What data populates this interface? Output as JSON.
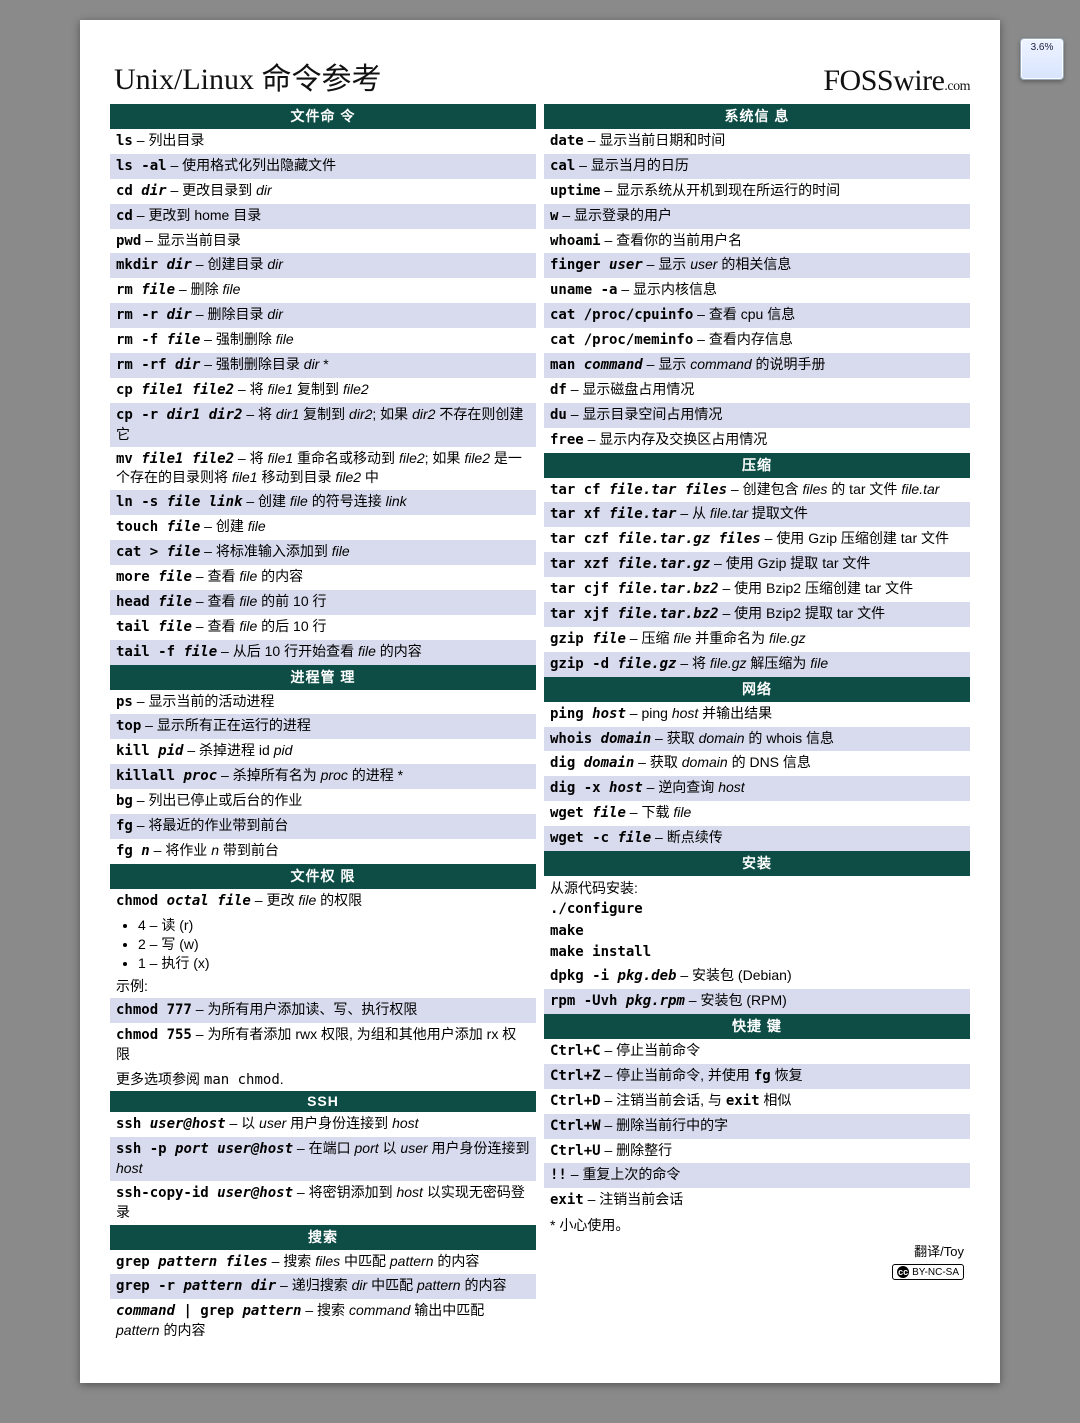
{
  "widget_label": "3.6%",
  "title": "Unix/Linux 命令参考",
  "brand_main": "FOSSwire",
  "brand_suffix": ".com",
  "translator": "翻译/Toy <http://LinuxTOY.org>",
  "cc_text": "BY-NC-SA",
  "careful": "* 小心使用。",
  "left": [
    {
      "type": "head",
      "text": "文件命 令"
    },
    {
      "type": "row",
      "cmd": [
        {
          "t": "ls",
          "b": 1
        }
      ],
      "desc": "列出目录"
    },
    {
      "type": "row",
      "cmd": [
        {
          "t": "ls -al",
          "b": 1
        }
      ],
      "desc": "使用格式化列出隐藏文件"
    },
    {
      "type": "row",
      "cmd": [
        {
          "t": "cd ",
          "b": 1
        },
        {
          "t": "dir",
          "b": 1,
          "i": 1
        }
      ],
      "desc": "更改目录到 <i>dir</i>"
    },
    {
      "type": "row",
      "cmd": [
        {
          "t": "cd",
          "b": 1
        }
      ],
      "desc": "更改到 home 目录"
    },
    {
      "type": "row",
      "cmd": [
        {
          "t": "pwd",
          "b": 1
        }
      ],
      "desc": "显示当前目录"
    },
    {
      "type": "row",
      "cmd": [
        {
          "t": "mkdir ",
          "b": 1
        },
        {
          "t": "dir",
          "b": 1,
          "i": 1
        }
      ],
      "desc": "创建目录 <i>dir</i>"
    },
    {
      "type": "row",
      "cmd": [
        {
          "t": "rm ",
          "b": 1
        },
        {
          "t": "file",
          "b": 1,
          "i": 1
        }
      ],
      "desc": "删除 <i>file</i>"
    },
    {
      "type": "row",
      "cmd": [
        {
          "t": "rm -r ",
          "b": 1
        },
        {
          "t": "dir",
          "b": 1,
          "i": 1
        }
      ],
      "desc": "删除目录 <i>dir</i>"
    },
    {
      "type": "row",
      "cmd": [
        {
          "t": "rm -f ",
          "b": 1
        },
        {
          "t": "file",
          "b": 1,
          "i": 1
        }
      ],
      "desc": "强制删除 <i>file</i>"
    },
    {
      "type": "row",
      "cmd": [
        {
          "t": "rm -rf ",
          "b": 1
        },
        {
          "t": "dir",
          "b": 1,
          "i": 1
        }
      ],
      "desc": "强制删除目录 <i>dir</i> *"
    },
    {
      "type": "row",
      "cmd": [
        {
          "t": "cp ",
          "b": 1
        },
        {
          "t": "file1 file2",
          "b": 1,
          "i": 1
        }
      ],
      "desc": "将 <i>file1</i> 复制到 <i>file2</i>"
    },
    {
      "type": "row",
      "cmd": [
        {
          "t": "cp -r ",
          "b": 1
        },
        {
          "t": "dir1 dir2",
          "b": 1,
          "i": 1
        }
      ],
      "desc": "将 <i>dir1</i> 复制到 <i>dir2</i>; 如果 <i>dir2</i> 不存在则创建它"
    },
    {
      "type": "row",
      "cmd": [
        {
          "t": "mv ",
          "b": 1
        },
        {
          "t": "file1 file2",
          "b": 1,
          "i": 1
        }
      ],
      "desc": "将 <i>file1</i> 重命名或移动到 <i>file2</i>; 如果 <i>file2</i> 是一个存在的目录则将 <i>file1</i> 移动到目录 <i>file2</i> 中"
    },
    {
      "type": "row",
      "cmd": [
        {
          "t": "ln -s ",
          "b": 1
        },
        {
          "t": "file link",
          "b": 1,
          "i": 1
        }
      ],
      "desc": "创建 <i>file</i> 的符号连接 <i>link</i>"
    },
    {
      "type": "row",
      "cmd": [
        {
          "t": "touch ",
          "b": 1
        },
        {
          "t": "file",
          "b": 1,
          "i": 1
        }
      ],
      "desc": "创建 <i>file</i>"
    },
    {
      "type": "row",
      "cmd": [
        {
          "t": "cat > ",
          "b": 1
        },
        {
          "t": "file",
          "b": 1,
          "i": 1
        }
      ],
      "desc": "将标准输入添加到 <i>file</i>"
    },
    {
      "type": "row",
      "cmd": [
        {
          "t": "more ",
          "b": 1
        },
        {
          "t": "file",
          "b": 1,
          "i": 1
        }
      ],
      "desc": "查看 <i>file</i> 的内容"
    },
    {
      "type": "row",
      "cmd": [
        {
          "t": "head ",
          "b": 1
        },
        {
          "t": "file",
          "b": 1,
          "i": 1
        }
      ],
      "desc": "查看 <i>file</i> 的前 10 行"
    },
    {
      "type": "row",
      "cmd": [
        {
          "t": "tail ",
          "b": 1
        },
        {
          "t": "file",
          "b": 1,
          "i": 1
        }
      ],
      "desc": "查看 <i>file</i> 的后 10 行"
    },
    {
      "type": "row",
      "cmd": [
        {
          "t": "tail -f ",
          "b": 1
        },
        {
          "t": "file",
          "b": 1,
          "i": 1
        }
      ],
      "desc": "从后 10 行开始查看 <i>file</i> 的内容"
    },
    {
      "type": "head",
      "text": "进程管 理"
    },
    {
      "type": "row",
      "cmd": [
        {
          "t": "ps",
          "b": 1
        }
      ],
      "desc": "显示当前的活动进程"
    },
    {
      "type": "row",
      "cmd": [
        {
          "t": "top",
          "b": 1
        }
      ],
      "desc": "显示所有正在运行的进程"
    },
    {
      "type": "row",
      "cmd": [
        {
          "t": "kill ",
          "b": 1
        },
        {
          "t": "pid",
          "b": 1,
          "i": 1
        }
      ],
      "desc": "杀掉进程 id <i>pid</i>"
    },
    {
      "type": "row",
      "cmd": [
        {
          "t": "killall ",
          "b": 1
        },
        {
          "t": "proc",
          "b": 1,
          "i": 1
        }
      ],
      "desc": "杀掉所有名为 <i>proc</i> 的进程 *"
    },
    {
      "type": "row",
      "cmd": [
        {
          "t": "bg",
          "b": 1
        }
      ],
      "desc": "列出已停止或后台的作业"
    },
    {
      "type": "row",
      "cmd": [
        {
          "t": "fg",
          "b": 1
        }
      ],
      "desc": "将最近的作业带到前台"
    },
    {
      "type": "row",
      "cmd": [
        {
          "t": "fg ",
          "b": 1
        },
        {
          "t": "n",
          "b": 1,
          "i": 1
        }
      ],
      "desc": "将作业 <i>n</i> 带到前台"
    },
    {
      "type": "head",
      "text": "文件权 限"
    },
    {
      "type": "row",
      "cmd": [
        {
          "t": "chmod ",
          "b": 1
        },
        {
          "t": "octal file",
          "b": 1,
          "i": 1
        }
      ],
      "desc": "更改 <i>file</i> 的权限"
    },
    {
      "type": "raw",
      "html": "<ul class='oct'><li>4 – 读 (r)</li><li>2 – 写 (w)</li><li>1 – 执行 (x)</li></ul>"
    },
    {
      "type": "raw",
      "html": "<div class='note'>示例:</div>"
    },
    {
      "type": "row",
      "cmd": [
        {
          "t": "chmod 777",
          "b": 1
        }
      ],
      "desc": "为所有用户添加读、写、执行权限"
    },
    {
      "type": "row",
      "cmd": [
        {
          "t": "chmod 755",
          "b": 1
        }
      ],
      "desc": "为所有者添加 rwx 权限, 为组和其他用户添加 rx 权限"
    },
    {
      "type": "raw",
      "html": "<div class='note'>更多选项参阅 <span class='mono'>man chmod</span>.</div>"
    },
    {
      "type": "head",
      "text": "SSH"
    },
    {
      "type": "row",
      "cmd": [
        {
          "t": "ssh ",
          "b": 1
        },
        {
          "t": "user@host",
          "b": 1,
          "i": 1
        }
      ],
      "desc": "以 <i>user</i> 用户身份连接到 <i>host</i>"
    },
    {
      "type": "row",
      "cmd": [
        {
          "t": "ssh -p ",
          "b": 1
        },
        {
          "t": "port user@host",
          "b": 1,
          "i": 1
        }
      ],
      "desc": "在端口 <i>port</i> 以 <i>user</i> 用户身份连接到 <i>host</i>"
    },
    {
      "type": "row",
      "cmd": [
        {
          "t": "ssh-copy-id ",
          "b": 1
        },
        {
          "t": "user@host",
          "b": 1,
          "i": 1
        }
      ],
      "desc": "将密钥添加到 <i>host</i> 以实现无密码登录"
    },
    {
      "type": "head",
      "text": "搜索"
    },
    {
      "type": "row",
      "cmd": [
        {
          "t": "grep ",
          "b": 1
        },
        {
          "t": "pattern files",
          "b": 1,
          "i": 1
        }
      ],
      "desc": "搜索 <i>files</i> 中匹配 <i>pattern</i> 的内容"
    },
    {
      "type": "row",
      "cmd": [
        {
          "t": "grep -r ",
          "b": 1
        },
        {
          "t": "pattern dir",
          "b": 1,
          "i": 1
        }
      ],
      "desc": "递归搜索 <i>dir</i> 中匹配 <i>pattern</i> 的内容"
    },
    {
      "type": "row",
      "cmd": [
        {
          "t": "command",
          "b": 1,
          "i": 1
        },
        {
          "t": " | grep ",
          "b": 1
        },
        {
          "t": "pattern",
          "b": 1,
          "i": 1
        }
      ],
      "desc": "搜索 <i>command</i> 输出中匹配 <i>pattern</i> 的内容"
    }
  ],
  "right": [
    {
      "type": "head",
      "text": "系统信 息"
    },
    {
      "type": "row",
      "cmd": [
        {
          "t": "date",
          "b": 1
        }
      ],
      "desc": "显示当前日期和时间"
    },
    {
      "type": "row",
      "cmd": [
        {
          "t": "cal",
          "b": 1
        }
      ],
      "desc": "显示当月的日历"
    },
    {
      "type": "row",
      "cmd": [
        {
          "t": "uptime",
          "b": 1
        }
      ],
      "desc": "显示系统从开机到现在所运行的时间"
    },
    {
      "type": "row",
      "cmd": [
        {
          "t": "w",
          "b": 1
        }
      ],
      "desc": "显示登录的用户"
    },
    {
      "type": "row",
      "cmd": [
        {
          "t": "whoami",
          "b": 1
        }
      ],
      "desc": "查看你的当前用户名"
    },
    {
      "type": "row",
      "cmd": [
        {
          "t": "finger ",
          "b": 1
        },
        {
          "t": "user",
          "b": 1,
          "i": 1
        }
      ],
      "desc": "显示 <i>user</i> 的相关信息"
    },
    {
      "type": "row",
      "cmd": [
        {
          "t": "uname -a",
          "b": 1
        }
      ],
      "desc": "显示内核信息"
    },
    {
      "type": "row",
      "cmd": [
        {
          "t": "cat /proc/cpuinfo",
          "b": 1
        }
      ],
      "desc": "查看 cpu 信息"
    },
    {
      "type": "row",
      "cmd": [
        {
          "t": "cat /proc/meminfo",
          "b": 1
        }
      ],
      "desc": "查看内存信息"
    },
    {
      "type": "row",
      "cmd": [
        {
          "t": "man ",
          "b": 1
        },
        {
          "t": "command",
          "b": 1,
          "i": 1
        }
      ],
      "desc": "显示 <i>command</i> 的说明手册"
    },
    {
      "type": "row",
      "cmd": [
        {
          "t": "df",
          "b": 1
        }
      ],
      "desc": "显示磁盘占用情况"
    },
    {
      "type": "row",
      "cmd": [
        {
          "t": "du",
          "b": 1
        }
      ],
      "desc": "显示目录空间占用情况"
    },
    {
      "type": "row",
      "cmd": [
        {
          "t": "free",
          "b": 1
        }
      ],
      "desc": "显示内存及交换区占用情况"
    },
    {
      "type": "head",
      "text": "压缩"
    },
    {
      "type": "row",
      "cmd": [
        {
          "t": "tar cf ",
          "b": 1
        },
        {
          "t": "file.tar files",
          "b": 1,
          "i": 1
        }
      ],
      "desc": "创建包含 <i>files</i> 的 tar 文件 <i>file.tar</i>"
    },
    {
      "type": "row",
      "cmd": [
        {
          "t": "tar xf ",
          "b": 1
        },
        {
          "t": "file.tar",
          "b": 1,
          "i": 1
        }
      ],
      "desc": "从 <i>file.tar</i> 提取文件"
    },
    {
      "type": "row",
      "cmd": [
        {
          "t": "tar czf ",
          "b": 1
        },
        {
          "t": "file.tar.gz files",
          "b": 1,
          "i": 1
        }
      ],
      "desc": "使用 Gzip 压缩创建 tar 文件"
    },
    {
      "type": "row",
      "cmd": [
        {
          "t": "tar xzf ",
          "b": 1
        },
        {
          "t": "file.tar.gz",
          "b": 1,
          "i": 1
        }
      ],
      "desc": "使用 Gzip 提取 tar 文件"
    },
    {
      "type": "row",
      "cmd": [
        {
          "t": "tar cjf ",
          "b": 1
        },
        {
          "t": "file.tar.bz2",
          "b": 1,
          "i": 1
        }
      ],
      "desc": "使用 Bzip2 压缩创建 tar 文件"
    },
    {
      "type": "row",
      "cmd": [
        {
          "t": "tar xjf ",
          "b": 1
        },
        {
          "t": "file.tar.bz2",
          "b": 1,
          "i": 1
        }
      ],
      "desc": "使用 Bzip2 提取 tar 文件"
    },
    {
      "type": "row",
      "cmd": [
        {
          "t": "gzip ",
          "b": 1
        },
        {
          "t": "file",
          "b": 1,
          "i": 1
        }
      ],
      "desc": "压缩 <i>file</i> 并重命名为 <i>file.gz</i>"
    },
    {
      "type": "row",
      "cmd": [
        {
          "t": "gzip -d ",
          "b": 1
        },
        {
          "t": "file.gz",
          "b": 1,
          "i": 1
        }
      ],
      "desc": "将 <i>file.gz</i> 解压缩为 <i>file</i>"
    },
    {
      "type": "head",
      "text": "网络"
    },
    {
      "type": "row",
      "cmd": [
        {
          "t": "ping ",
          "b": 1
        },
        {
          "t": "host",
          "b": 1,
          "i": 1
        }
      ],
      "desc": "ping <i>host</i> 并输出结果"
    },
    {
      "type": "row",
      "cmd": [
        {
          "t": "whois ",
          "b": 1
        },
        {
          "t": "domain",
          "b": 1,
          "i": 1
        }
      ],
      "desc": "获取 <i>domain</i> 的 whois 信息"
    },
    {
      "type": "row",
      "cmd": [
        {
          "t": "dig ",
          "b": 1
        },
        {
          "t": "domain",
          "b": 1,
          "i": 1
        }
      ],
      "desc": "获取 <i>domain</i> 的 DNS 信息"
    },
    {
      "type": "row",
      "cmd": [
        {
          "t": "dig -x ",
          "b": 1
        },
        {
          "t": "host",
          "b": 1,
          "i": 1
        }
      ],
      "desc": "逆向查询 <i>host</i>"
    },
    {
      "type": "row",
      "cmd": [
        {
          "t": "wget ",
          "b": 1
        },
        {
          "t": "file",
          "b": 1,
          "i": 1
        }
      ],
      "desc": "下载 <i>file</i>"
    },
    {
      "type": "row",
      "cmd": [
        {
          "t": "wget -c ",
          "b": 1
        },
        {
          "t": "file",
          "b": 1,
          "i": 1
        }
      ],
      "desc": "断点续传"
    },
    {
      "type": "head",
      "text": "安装"
    },
    {
      "type": "raw",
      "html": "<div class='freeblock'>从源代码安装:<br><span class='mono'><b>./configure</b><br><b>make</b><br><b>make install</b></span></div>"
    },
    {
      "type": "row",
      "cmd": [
        {
          "t": "dpkg -i ",
          "b": 1
        },
        {
          "t": "pkg.deb",
          "b": 1,
          "i": 1
        }
      ],
      "desc": "安装包 (Debian)"
    },
    {
      "type": "row",
      "cmd": [
        {
          "t": "rpm -Uvh ",
          "b": 1
        },
        {
          "t": "pkg.rpm",
          "b": 1,
          "i": 1
        }
      ],
      "desc": "安装包 (RPM)"
    },
    {
      "type": "head",
      "text": "快捷 键"
    },
    {
      "type": "row",
      "cmd": [
        {
          "t": "Ctrl+C",
          "b": 1
        }
      ],
      "desc": "停止当前命令"
    },
    {
      "type": "row",
      "cmd": [
        {
          "t": "Ctrl+Z",
          "b": 1
        }
      ],
      "desc": "停止当前命令, 并使用 <span class='mono'><b>fg</b></span> 恢复"
    },
    {
      "type": "row",
      "cmd": [
        {
          "t": "Ctrl+D",
          "b": 1
        }
      ],
      "desc": "注销当前会话, 与 <span class='mono'><b>exit</b></span> 相似"
    },
    {
      "type": "row",
      "cmd": [
        {
          "t": "Ctrl+W",
          "b": 1
        }
      ],
      "desc": "删除当前行中的字"
    },
    {
      "type": "row",
      "cmd": [
        {
          "t": "Ctrl+U",
          "b": 1
        }
      ],
      "desc": "删除整行"
    },
    {
      "type": "row",
      "cmd": [
        {
          "t": "!!",
          "b": 1
        }
      ],
      "desc": "重复上次的命令"
    },
    {
      "type": "row",
      "cmd": [
        {
          "t": "exit",
          "b": 1
        }
      ],
      "desc": "注销当前会话"
    }
  ]
}
